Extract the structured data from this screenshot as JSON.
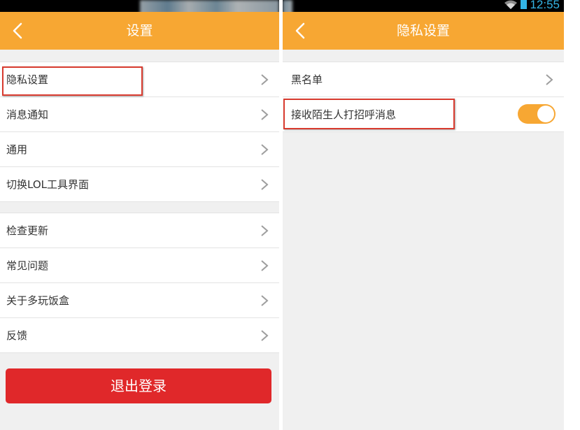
{
  "colors": {
    "accent": "#f7a733",
    "danger": "#e0282a",
    "highlight": "#d83a2e",
    "background": "#f0f0f0"
  },
  "status_bar": {
    "time": "12:55",
    "icons": [
      "wifi-icon",
      "battery-icon"
    ]
  },
  "left_screen": {
    "title": "设置",
    "group1": [
      {
        "label": "隐私设置",
        "icon": "chevron-right-icon"
      },
      {
        "label": "消息通知",
        "icon": "chevron-right-icon"
      },
      {
        "label": "通用",
        "icon": "chevron-right-icon"
      },
      {
        "label": "切换LOL工具界面",
        "icon": "chevron-right-icon"
      }
    ],
    "group2": [
      {
        "label": "检查更新",
        "icon": "chevron-right-icon"
      },
      {
        "label": "常见问题",
        "icon": "chevron-right-icon"
      },
      {
        "label": "关于多玩饭盒",
        "icon": "chevron-right-icon"
      },
      {
        "label": "反馈",
        "icon": "chevron-right-icon"
      }
    ],
    "logout_label": "退出登录"
  },
  "right_screen": {
    "title": "隐私设置",
    "items": [
      {
        "label": "黑名单",
        "icon": "chevron-right-icon"
      },
      {
        "label": "接收陌生人打招呼消息",
        "toggle_on": true
      }
    ]
  }
}
